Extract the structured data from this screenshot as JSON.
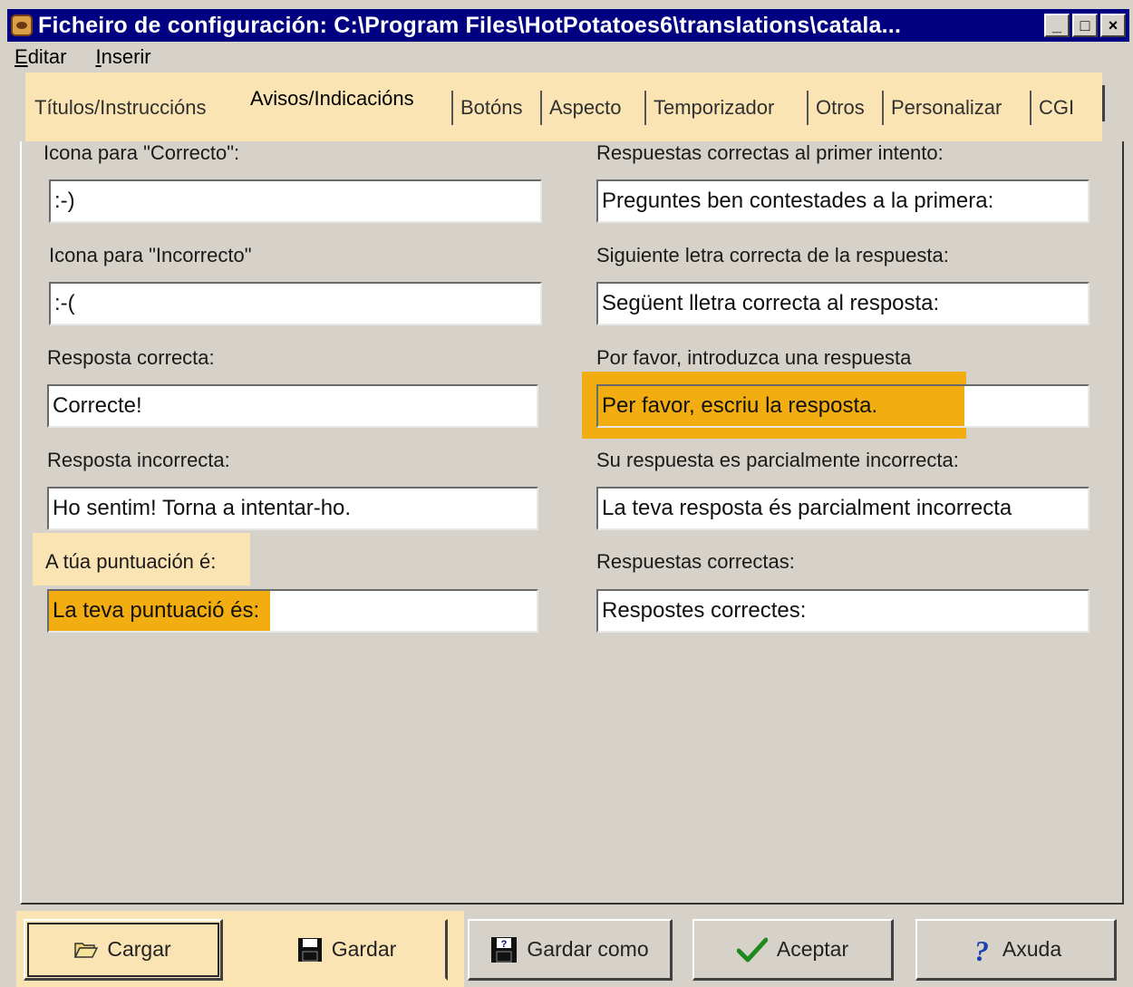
{
  "window": {
    "title": "Ficheiro de configuración: C:\\Program Files\\HotPotatoes6\\translations\\catala...",
    "controls": {
      "minimize": "_",
      "maximize": "□",
      "close": "×"
    }
  },
  "menu": [
    {
      "label_first": "E",
      "label_rest": "ditar"
    },
    {
      "label_first": "I",
      "label_rest": "nserir"
    }
  ],
  "tabs": [
    {
      "label": "Títulos/Instruccións"
    },
    {
      "label": "Avisos/Indicacións",
      "active": true
    },
    {
      "label": "Botóns"
    },
    {
      "label": "Aspecto"
    },
    {
      "label": "Temporizador"
    },
    {
      "label": "Otros"
    },
    {
      "label": "Personalizar"
    },
    {
      "label": "CGI"
    }
  ],
  "left_fields": [
    {
      "label": "Icona para \"Correcto\":",
      "value": ":-)"
    },
    {
      "label": "Icona para \"Incorrecto\"",
      "value": ":-("
    },
    {
      "label": "Resposta correcta:",
      "value": "Correcte!"
    },
    {
      "label": "Resposta incorrecta:",
      "value": "Ho sentim! Torna a intentar-ho."
    },
    {
      "label": "A túa puntuación é:",
      "value": "La teva puntuació és:"
    }
  ],
  "right_fields": [
    {
      "label": "Respuestas correctas al primer intento:",
      "value": "Preguntes ben contestades a la primera:"
    },
    {
      "label": "Siguiente letra correcta de la respuesta:",
      "value": "Següent lletra correcta al resposta:"
    },
    {
      "label": "Por favor, introduzca una respuesta",
      "value": "Per favor, escriu la resposta."
    },
    {
      "label": "Su respuesta es parcialmente incorrecta:",
      "value": "La teva resposta és parcialment incorrecta"
    },
    {
      "label": "Respuestas correctas:",
      "value": "Respostes correctes:"
    }
  ],
  "buttons": [
    {
      "label": "Cargar",
      "icon": "folder-open-icon"
    },
    {
      "label": "Gardar",
      "icon": "floppy-disk-icon"
    },
    {
      "label": "Gardar como",
      "icon": "floppy-save-as-icon"
    },
    {
      "label": "Aceptar",
      "icon": "checkmark-icon"
    },
    {
      "label": "Axuda",
      "icon": "question-mark-icon"
    }
  ],
  "colors": {
    "title_bar": "#000080",
    "highlight_orange": "#f2ad10",
    "highlight_beige": "#fbe4b3",
    "window_face": "#d6d2c9"
  }
}
